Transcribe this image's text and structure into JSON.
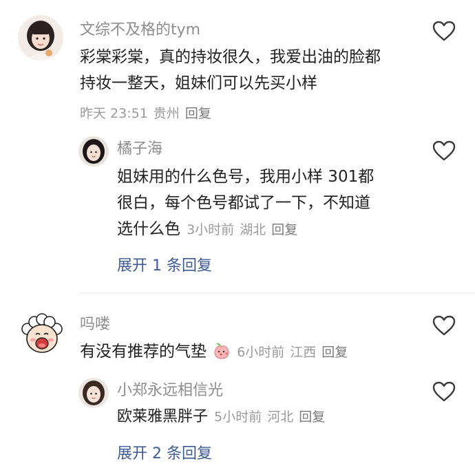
{
  "comments": [
    {
      "username": "文综不及格的tym",
      "text_line1": "彩棠彩棠，真的持妆很久，我爱出油的脸都",
      "text_line2": "持妆一整天，姐妹们可以先买小样",
      "time": "昨天 23:51",
      "location": "贵州",
      "reply_label": "回复",
      "replies": [
        {
          "username": "橘子海",
          "text_line1": "姐妹用的什么色号，我用小样 301都",
          "text_line2": "很白，每个色号都试了一下，不知道",
          "text_line3": "选什么色",
          "time": "3小时前",
          "location": "湖北",
          "reply_label": "回复"
        }
      ],
      "expand_label": "展开 1 条回复"
    },
    {
      "username": "吗喽",
      "text": "有没有推荐的气垫",
      "emoji_icon": "peach-blowing-kiss-emoji",
      "time": "6小时前",
      "location": "江西",
      "reply_label": "回复",
      "replies": [
        {
          "username": "小郑永远相信光",
          "text": "欧莱雅黑胖子",
          "time": "5小时前",
          "location": "河北",
          "reply_label": "回复"
        }
      ],
      "expand_label": "展开 2 条回复"
    }
  ],
  "icons": {
    "like": "heart-outline-icon"
  },
  "colors": {
    "username": "#8d8d8d",
    "meta": "#9a9a9a",
    "expand": "#3d5a99",
    "text": "#222222"
  }
}
